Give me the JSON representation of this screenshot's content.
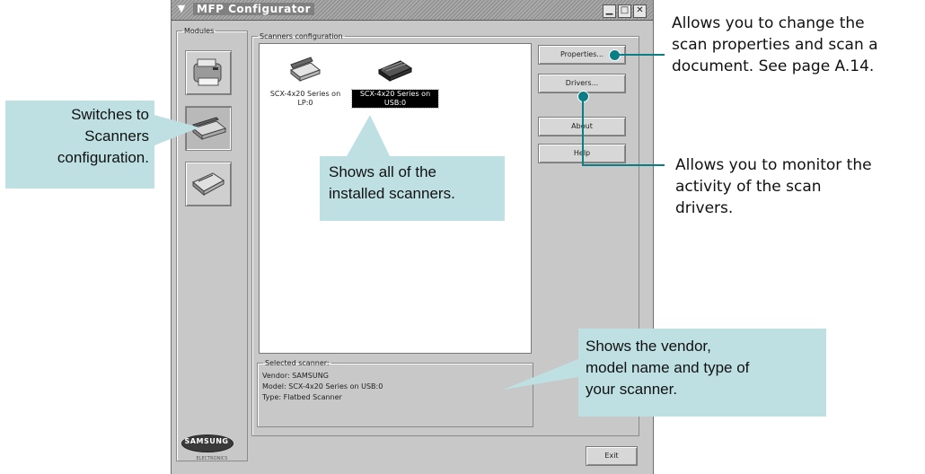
{
  "window": {
    "title": "MFP Configurator",
    "menu_icon": "chevron-down-icon",
    "controls": [
      "minimize-icon",
      "maximize-icon",
      "close-icon"
    ]
  },
  "modules": {
    "legend": "Modules",
    "items": [
      {
        "name": "printers-module",
        "icon": "printer-icon"
      },
      {
        "name": "scanners-module",
        "icon": "scanner-icon",
        "active": true
      },
      {
        "name": "ports-module",
        "icon": "port-icon"
      }
    ]
  },
  "scanners": {
    "legend": "Scanners configuration",
    "items": [
      {
        "label_line1": "SCX-4x20 Series on",
        "label_line2": "LP:0",
        "selected": false
      },
      {
        "label_line1": "SCX-4x20 Series on",
        "label_line2": "USB:0",
        "selected": true
      }
    ]
  },
  "selected_scanner": {
    "legend": "Selected scanner:",
    "vendor": "Vendor: SAMSUNG",
    "model": "Model: SCX-4x20 Series on USB:0",
    "type": "Type: Flatbed Scanner"
  },
  "buttons": {
    "properties": "Properties...",
    "drivers": "Drivers...",
    "about": "About",
    "help": "Help",
    "exit": "Exit"
  },
  "logo": {
    "brand": "SAMSUNG",
    "sub": "ELECTRONICS"
  },
  "callouts": {
    "switches": [
      "Switches to",
      "Scanners",
      "configuration."
    ],
    "shows_all": [
      "Shows all of the",
      "installed scanners."
    ],
    "vendor": [
      "Shows the vendor,",
      "model name and type of",
      "your scanner."
    ],
    "properties": [
      "Allows you to change the",
      "scan properties and scan a",
      "document. See page A.14."
    ],
    "drivers": [
      "Allows you to monitor the",
      "activity of the scan",
      "drivers."
    ]
  },
  "colors": {
    "callout_bg": "#bfe0e3",
    "accent": "#0b7d85"
  }
}
